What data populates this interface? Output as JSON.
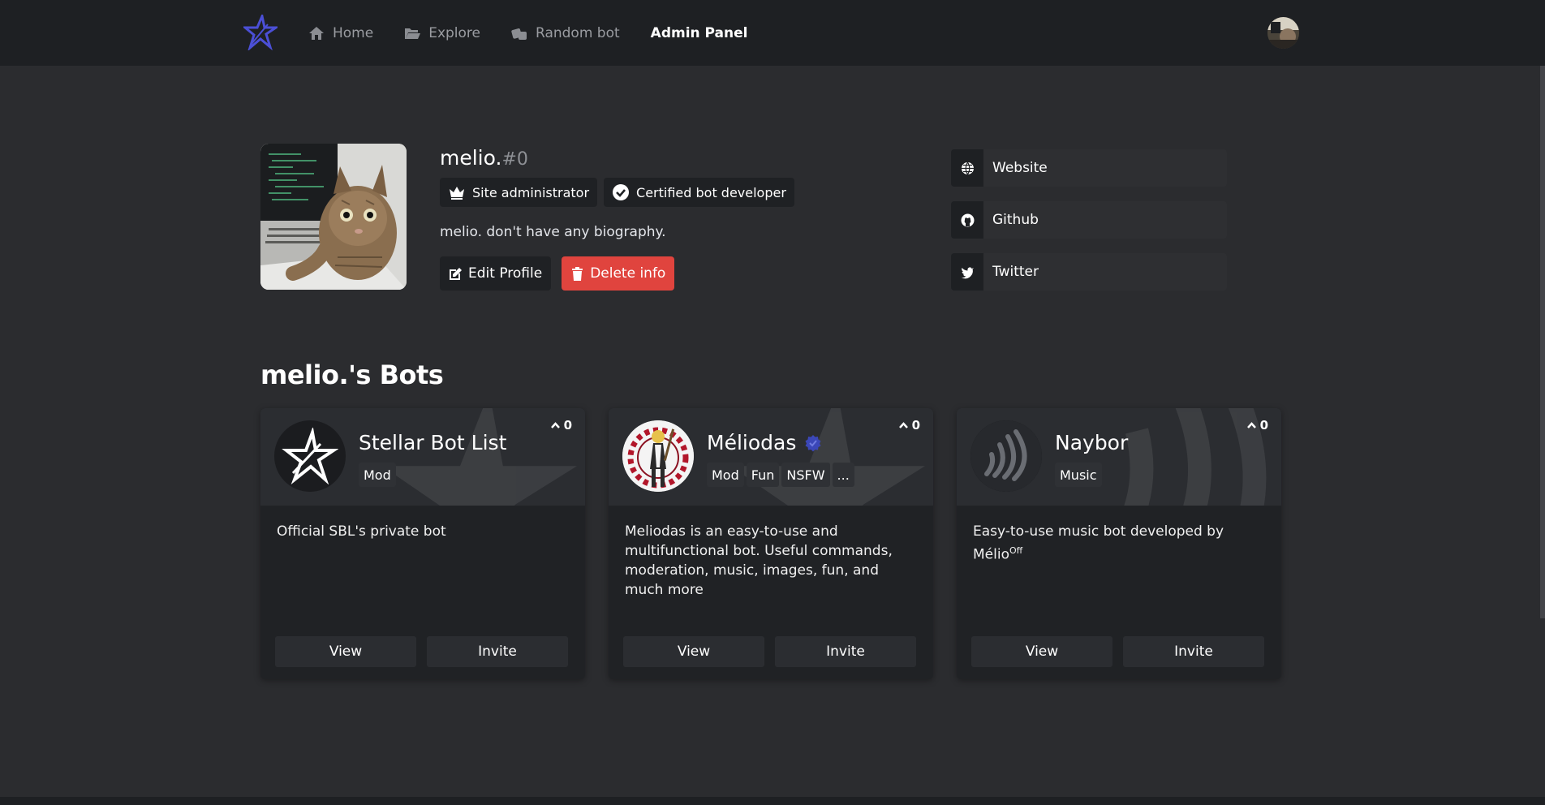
{
  "nav": {
    "items": [
      {
        "label": "Home",
        "icon": "home-icon"
      },
      {
        "label": "Explore",
        "icon": "folder-open-icon"
      },
      {
        "label": "Random bot",
        "icon": "dice-icon"
      },
      {
        "label": "Admin Panel",
        "icon": ""
      }
    ],
    "active": "Admin Panel"
  },
  "profile": {
    "username": "melio.",
    "discriminator": "#0",
    "badges": [
      {
        "label": "Site administrator",
        "icon": "crown-icon"
      },
      {
        "label": "Certified bot developer",
        "icon": "check-circle-icon"
      }
    ],
    "bio": "melio. don't have any biography.",
    "edit_label": "Edit Profile",
    "delete_label": "Delete info",
    "links": [
      {
        "label": "Website",
        "icon": "globe-icon"
      },
      {
        "label": "Github",
        "icon": "github-icon"
      },
      {
        "label": "Twitter",
        "icon": "twitter-icon"
      }
    ]
  },
  "bots_section": {
    "title": "melio.'s Bots",
    "bots": [
      {
        "name": "Stellar Bot List",
        "tags": [
          "Mod"
        ],
        "votes": "0",
        "description": "Official SBL's private bot",
        "verified": false,
        "view_label": "View",
        "invite_label": "Invite"
      },
      {
        "name": "Méliodas",
        "tags": [
          "Mod",
          "Fun",
          "NSFW",
          "..."
        ],
        "votes": "0",
        "description": "Meliodas is an easy-to-use and multifunctional bot. Useful commands, moderation, music, images, fun, and much more",
        "verified": true,
        "view_label": "View",
        "invite_label": "Invite"
      },
      {
        "name": "Naybor",
        "tags": [
          "Music"
        ],
        "votes": "0",
        "description": "Easy-to-use music bot developed by Mélio",
        "description_sup": "Off",
        "verified": false,
        "view_label": "View",
        "invite_label": "Invite"
      }
    ]
  },
  "colors": {
    "background": "#2b2c2f",
    "navbar": "#1e2023",
    "card": "#202225",
    "danger": "#e0443e",
    "brand": "#4b4fd6",
    "verified": "#3b47b8"
  }
}
